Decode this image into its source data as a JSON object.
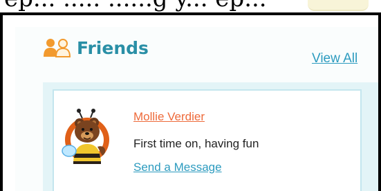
{
  "top_fragment": {
    "text": "ep... ..... ......g y... ep..."
  },
  "friends": {
    "icon": "friends-icon",
    "title": "Friends",
    "view_all_label": "View All",
    "accent_color": "#2a8fa6",
    "link_color": "#2c9bbf"
  },
  "friend_list": [
    {
      "avatar": "bear-bee-avatar",
      "name": "Mollie Verdier",
      "status": "First time on, having fun",
      "action_label": "Send a Message"
    }
  ],
  "colors": {
    "name_link": "#ee6a3a",
    "panel_bg": "#e3f4f7",
    "card_border": "#c4e6ee"
  }
}
